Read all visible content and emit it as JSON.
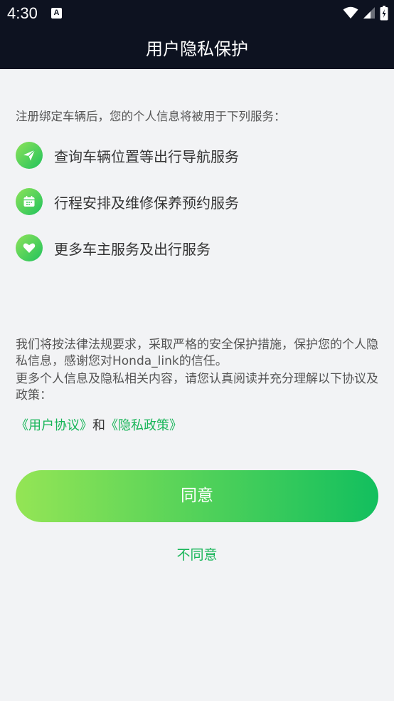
{
  "status_bar": {
    "time": "4:30",
    "notification_badge": "A"
  },
  "header": {
    "title": "用户隐私保护"
  },
  "intro": "注册绑定车辆后，您的个人信息将被用于下列服务：",
  "services": [
    {
      "icon": "paper-plane-icon",
      "label": "查询车辆位置等出行导航服务"
    },
    {
      "icon": "calendar-icon",
      "label": "行程安排及维修保养预约服务"
    },
    {
      "icon": "heart-icon",
      "label": "更多车主服务及出行服务"
    }
  ],
  "paragraphs": {
    "p1": "我们将按法律法规要求，采取严格的安全保护措施，保护您的个人隐私信息，感谢您对Honda_link的信任。",
    "p2": "更多个人信息及隐私相关内容，请您认真阅读并充分理解以下协议及政策："
  },
  "links": {
    "user_agreement": "《用户协议》",
    "conjunction": "和",
    "privacy_policy": "《隐私政策》"
  },
  "buttons": {
    "agree": "同意",
    "disagree": "不同意"
  },
  "colors": {
    "accent": "#17b558",
    "header_bg": "#0d1220",
    "page_bg": "#f2f3f5",
    "gradient_start": "#94e555",
    "gradient_end": "#12bf5e"
  }
}
